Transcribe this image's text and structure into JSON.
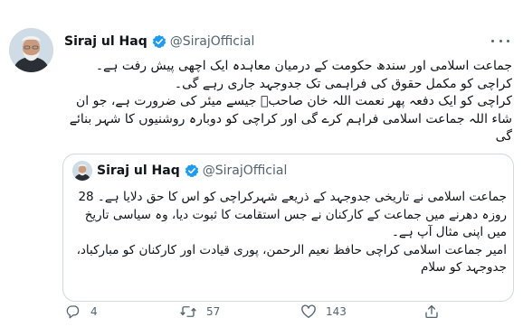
{
  "tweet": {
    "author": {
      "name": "Siraj ul Haq",
      "handle": "@SirajOfficial"
    },
    "text": [
      "جماعت اسلامی اور سندھ حکومت کے درمیان معاہدہ ایک اچھی پیش رفت ہے۔",
      "کراچی کو مکمل حقوق کی فراہمی تک جدوجہد جاری رہے گی۔",
      "کراچی کو ایک دفعہ پھر نعمت اللہ خان صاحبؒ جیسے میئر کی ضرورت ہے، جو ان شاء اللہ جماعت اسلامی فراہم کرے گی اور کراچی کو دوبارہ روشنیوں کا شہر بنائے گی"
    ],
    "quoted": {
      "author": {
        "name": "Siraj ul Haq",
        "handle": "@SirajOfficial"
      },
      "text": [
        "جماعت اسلامی نے تاریخی جدوجہد کے ذریعے شہرکراچی کو اس کا حق دلایا ہے۔ 28 روزہ دھرنے میں جماعت کے کارکنان نے جس استقامت کا ثبوت دیا، وہ سیاسی تاریخ میں اپنی مثال آپ ہے۔",
        "امیر جماعت اسلامی کراچی حافظ نعیم الرحمن، پوری قیادت اور کارکنان کو مبارکباد، جدوجہد کو سلام"
      ]
    },
    "actions": {
      "reply": {
        "icon": "reply-icon",
        "count": "4"
      },
      "retweet": {
        "icon": "retweet-icon",
        "count": "57"
      },
      "like": {
        "icon": "heart-icon",
        "count": "143"
      },
      "share": {
        "icon": "share-icon"
      }
    }
  },
  "colors": {
    "text": "#0f1419",
    "secondary": "#536471",
    "verified": "#1d9bf0",
    "border": "#cfd9de"
  }
}
